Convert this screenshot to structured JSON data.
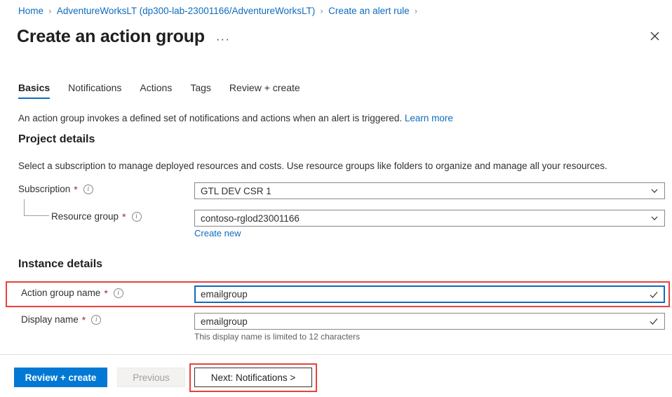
{
  "breadcrumb": {
    "items": [
      {
        "label": "Home"
      },
      {
        "label": "AdventureWorksLT (dp300-lab-23001166/AdventureWorksLT)"
      },
      {
        "label": "Create an alert rule"
      }
    ],
    "separator": "›"
  },
  "header": {
    "title": "Create an action group",
    "more_label": "···",
    "close_label": "✕"
  },
  "tabs": [
    {
      "label": "Basics",
      "active": true
    },
    {
      "label": "Notifications",
      "active": false
    },
    {
      "label": "Actions",
      "active": false
    },
    {
      "label": "Tags",
      "active": false
    },
    {
      "label": "Review + create",
      "active": false
    }
  ],
  "description": {
    "text": "An action group invokes a defined set of notifications and actions when an alert is triggered.",
    "link_label": "Learn more"
  },
  "project_details": {
    "heading": "Project details",
    "subtext": "Select a subscription to manage deployed resources and costs. Use resource groups like folders to organize and manage all your resources.",
    "subscription": {
      "label": "Subscription",
      "required_marker": "*",
      "info_glyph": "i",
      "value": "GTL DEV CSR 1"
    },
    "resource_group": {
      "label": "Resource group",
      "required_marker": "*",
      "info_glyph": "i",
      "value": "contoso-rglod23001166",
      "create_new_label": "Create new"
    }
  },
  "instance_details": {
    "heading": "Instance details",
    "action_group_name": {
      "label": "Action group name",
      "required_marker": "*",
      "info_glyph": "i",
      "value": "emailgroup"
    },
    "display_name": {
      "label": "Display name",
      "required_marker": "*",
      "info_glyph": "i",
      "value": "emailgroup",
      "helper_text": "This display name is limited to 12 characters"
    }
  },
  "footer": {
    "review_create_label": "Review + create",
    "previous_label": "Previous",
    "next_label": "Next: Notifications >"
  },
  "colors": {
    "accent_blue": "#0078d4",
    "link_blue": "#0f6cbd",
    "annotation_red": "#e8413c",
    "required_red": "#a4262c"
  }
}
